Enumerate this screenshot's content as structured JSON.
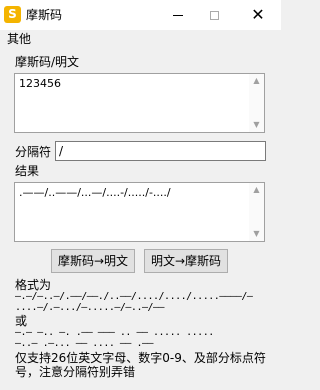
{
  "window": {
    "icon_letter": "S",
    "title": "摩斯码",
    "min_glyph": "",
    "close_glyph": "✕"
  },
  "menu": {
    "items": [
      {
        "label": "其他"
      }
    ]
  },
  "input": {
    "label": "摩斯码/明文",
    "value": "123456"
  },
  "separator": {
    "label": "分隔符",
    "value": "/"
  },
  "result": {
    "label": "结果",
    "value": ".——/..——/...—/....-/...../-..../"
  },
  "buttons": {
    "morse_to_text": "摩斯码→明文",
    "text_to_morse": "明文→摩斯码"
  },
  "help": {
    "format_label": "格式为",
    "example1_line1": "—.—/—..—/.——/——./..——/..../..../.....————/—",
    "example1_line2": "....—/.—.../—.....—/—..—/——",
    "or_label": "或",
    "example2_line1": "—.— —.. —. .—— ——— .. —— ..... .....",
    "example2_line2": "—..— .—... —— .... —— .——",
    "note_line1": "仅支持26位英文字母、数字0-9、及部分标点符",
    "note_line2": "号，注意分隔符别弄错"
  }
}
